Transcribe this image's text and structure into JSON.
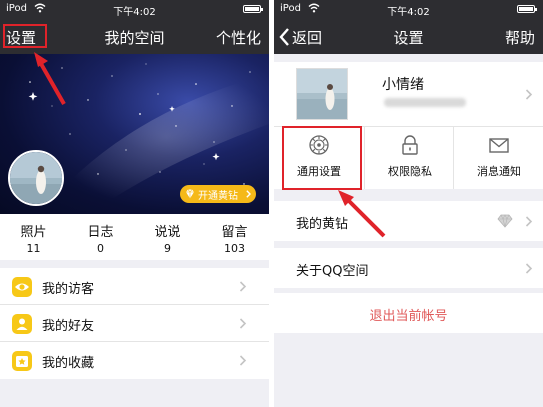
{
  "left_screen": {
    "status": {
      "carrier": "iPod",
      "time": "下午4:02"
    },
    "header": {
      "settings": "设置",
      "title": "我的空间",
      "personalize": "个性化"
    },
    "vip_button": "开通黄钻",
    "stats": [
      {
        "label": "照片",
        "value": "11"
      },
      {
        "label": "日志",
        "value": "0"
      },
      {
        "label": "说说",
        "value": "9"
      },
      {
        "label": "留言",
        "value": "103"
      }
    ],
    "menu": [
      {
        "label": "我的访客",
        "icon": "eye-icon"
      },
      {
        "label": "我的好友",
        "icon": "friend-icon"
      },
      {
        "label": "我的收藏",
        "icon": "star-icon"
      }
    ]
  },
  "right_screen": {
    "status": {
      "carrier": "iPod",
      "time": "下午4:02"
    },
    "header": {
      "back": "返回",
      "title": "设置",
      "help": "帮助"
    },
    "profile": {
      "name": "小情绪"
    },
    "grid": [
      {
        "label": "通用设置",
        "icon": "gear-icon"
      },
      {
        "label": "权限隐私",
        "icon": "lock-icon"
      },
      {
        "label": "消息通知",
        "icon": "mail-icon"
      }
    ],
    "rows": {
      "yellow_diamond": "我的黄钻",
      "about": "关于QQ空间"
    },
    "logout": "退出当前帐号"
  },
  "colors": {
    "nav_bg": "#2d2d31",
    "accent_yellow": "#f7c817",
    "highlight_red": "#e0232a",
    "logout_red": "#e05a5a"
  }
}
